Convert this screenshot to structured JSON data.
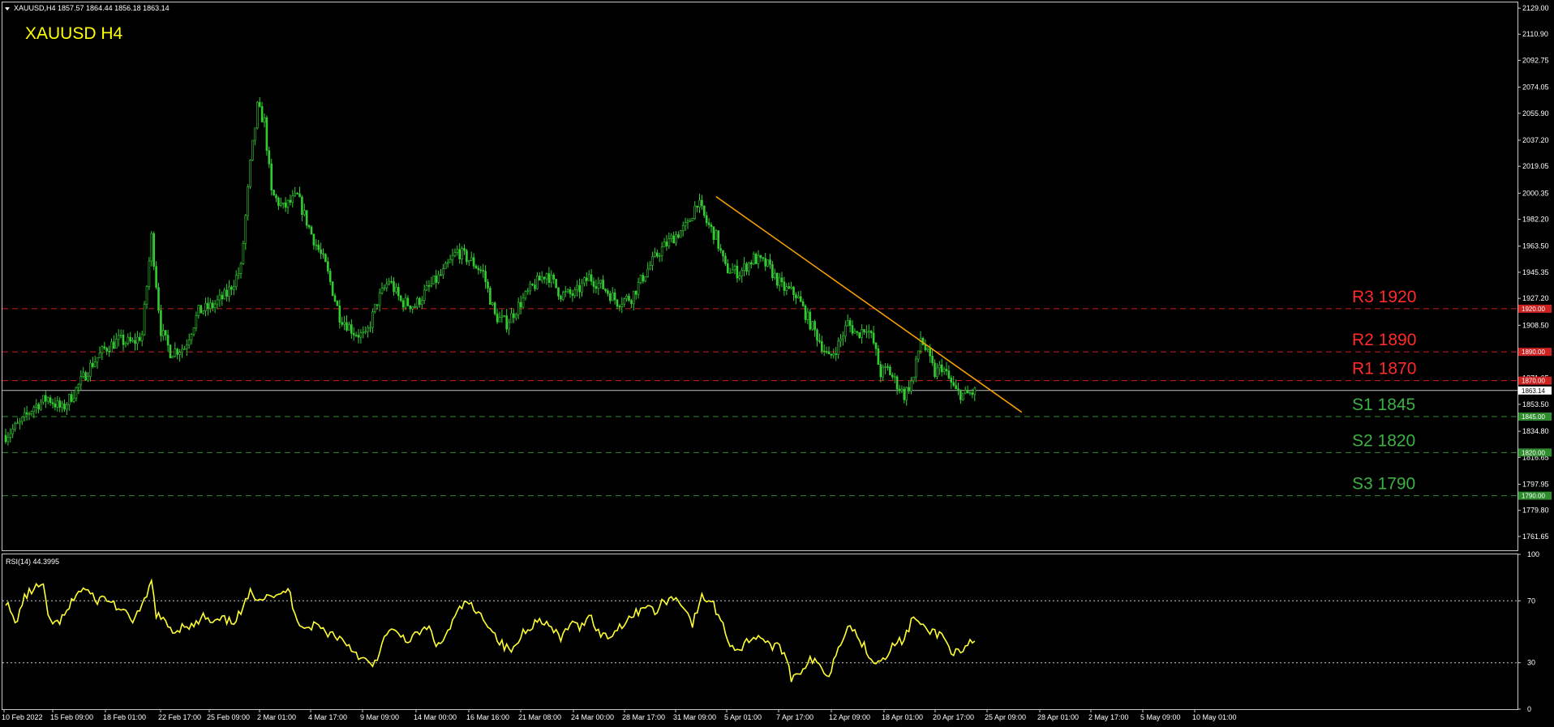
{
  "header": {
    "symbol_info": "XAUUSD,H4  1857.57 1864.44 1856.18 1863.14",
    "title": "XAUUSD H4"
  },
  "indicator": {
    "label": "RSI(14) 44.3995"
  },
  "colors": {
    "background": "#000000",
    "candle": "#33cc33",
    "rsi_line": "#ffff33",
    "trendline": "#ffa500",
    "resistance": "#cc2222",
    "support": "#2e8b2e",
    "current_price_line": "#c0c0c0",
    "title_text": "#ffff00",
    "resistance_text": "#ff2a2a",
    "support_text": "#3cb043"
  },
  "chart_data": [
    {
      "type": "candlestick",
      "title": "XAUUSD H4",
      "y_ticks": [
        "2129.00",
        "2110.90",
        "2092.75",
        "2074.05",
        "2055.90",
        "2037.20",
        "2019.05",
        "2000.35",
        "1982.20",
        "1963.50",
        "1945.35",
        "1927.20",
        "1908.50",
        "1871.65",
        "1853.50",
        "1834.80",
        "1816.65",
        "1797.95",
        "1779.80",
        "1761.65"
      ],
      "ylim": [
        1752,
        2133
      ],
      "x_ticks": [
        "10 Feb 2022",
        "15 Feb 09:00",
        "18 Feb 01:00",
        "22 Feb 17:00",
        "25 Feb 09:00",
        "2 Mar 01:00",
        "4 Mar 17:00",
        "9 Mar 09:00",
        "14 Mar 00:00",
        "16 Mar 16:00",
        "21 Mar 08:00",
        "24 Mar 00:00",
        "28 Mar 17:00",
        "31 Mar 09:00",
        "5 Apr 01:00",
        "7 Apr 17:00",
        "12 Apr 09:00",
        "18 Apr 01:00",
        "20 Apr 17:00",
        "25 Apr 09:00",
        "28 Apr 01:00",
        "2 May 17:00",
        "5 May 09:00",
        "10 May 01:00"
      ],
      "close_path": [
        [
          0,
          1832
        ],
        [
          6,
          1840
        ],
        [
          12,
          1852
        ],
        [
          18,
          1858
        ],
        [
          24,
          1850
        ],
        [
          30,
          1864
        ],
        [
          36,
          1880
        ],
        [
          42,
          1892
        ],
        [
          48,
          1898
        ],
        [
          54,
          1896
        ],
        [
          58,
          1902
        ],
        [
          62,
          1970
        ],
        [
          66,
          1905
        ],
        [
          70,
          1890
        ],
        [
          76,
          1893
        ],
        [
          82,
          1918
        ],
        [
          88,
          1922
        ],
        [
          94,
          1930
        ],
        [
          100,
          1948
        ],
        [
          104,
          2020
        ],
        [
          107,
          2060
        ],
        [
          110,
          2050
        ],
        [
          113,
          2000
        ],
        [
          118,
          1990
        ],
        [
          124,
          1998
        ],
        [
          130,
          1972
        ],
        [
          136,
          1950
        ],
        [
          142,
          1915
        ],
        [
          148,
          1904
        ],
        [
          153,
          1900
        ],
        [
          158,
          1925
        ],
        [
          163,
          1940
        ],
        [
          168,
          1925
        ],
        [
          174,
          1922
        ],
        [
          180,
          1935
        ],
        [
          186,
          1945
        ],
        [
          192,
          1960
        ],
        [
          198,
          1953
        ],
        [
          203,
          1945
        ],
        [
          208,
          1915
        ],
        [
          213,
          1910
        ],
        [
          218,
          1922
        ],
        [
          224,
          1935
        ],
        [
          230,
          1945
        ],
        [
          236,
          1930
        ],
        [
          242,
          1930
        ],
        [
          248,
          1942
        ],
        [
          254,
          1935
        ],
        [
          260,
          1925
        ],
        [
          266,
          1928
        ],
        [
          272,
          1945
        ],
        [
          278,
          1960
        ],
        [
          284,
          1970
        ],
        [
          290,
          1978
        ],
        [
          294,
          1995
        ],
        [
          298,
          1980
        ],
        [
          302,
          1970
        ],
        [
          306,
          1948
        ],
        [
          312,
          1945
        ],
        [
          318,
          1955
        ],
        [
          324,
          1950
        ],
        [
          330,
          1935
        ],
        [
          336,
          1930
        ],
        [
          342,
          1910
        ],
        [
          346,
          1898
        ],
        [
          350,
          1885
        ],
        [
          354,
          1895
        ],
        [
          358,
          1910
        ],
        [
          362,
          1902
        ],
        [
          366,
          1908
        ],
        [
          369,
          1896
        ],
        [
          372,
          1875
        ],
        [
          375,
          1878
        ],
        [
          378,
          1870
        ],
        [
          382,
          1860
        ],
        [
          386,
          1872
        ],
        [
          389,
          1900
        ],
        [
          392,
          1888
        ],
        [
          395,
          1875
        ],
        [
          398,
          1880
        ],
        [
          402,
          1868
        ],
        [
          404,
          1862
        ],
        [
          408,
          1860
        ],
        [
          412,
          1862
        ]
      ],
      "last_bar_index": 412,
      "current_price": 1863.14,
      "current_price_label": "1863.14",
      "levels": [
        {
          "name": "R3",
          "price": 1920,
          "text": "R3 1920",
          "axis_label": "1920.00",
          "kind": "resistance"
        },
        {
          "name": "R2",
          "price": 1890,
          "text": "R2 1890",
          "axis_label": "1890.00",
          "kind": "resistance"
        },
        {
          "name": "R1",
          "price": 1870,
          "text": "R1 1870",
          "axis_label": "1870.00",
          "kind": "resistance"
        },
        {
          "name": "S1",
          "price": 1845,
          "text": "S1 1845",
          "axis_label": "1845.00",
          "kind": "support"
        },
        {
          "name": "S2",
          "price": 1820,
          "text": "S2 1820",
          "axis_label": "1820.00",
          "kind": "support"
        },
        {
          "name": "S3",
          "price": 1790,
          "text": "S3 1790",
          "axis_label": "1790.00",
          "kind": "support"
        }
      ],
      "trendline": {
        "start": [
          302,
          1998
        ],
        "end": [
          432,
          1848
        ]
      }
    },
    {
      "type": "line",
      "title": "RSI(14) 44.3995",
      "ylim": [
        0,
        100
      ],
      "y_ticks": [
        "100",
        "70",
        "30",
        "0"
      ],
      "levels": [
        70,
        30
      ],
      "series": [
        {
          "name": "RSI(14)",
          "points": [
            [
              0,
              70
            ],
            [
              4,
              55
            ],
            [
              8,
              72
            ],
            [
              12,
              78
            ],
            [
              16,
              80
            ],
            [
              18,
              58
            ],
            [
              22,
              55
            ],
            [
              26,
              62
            ],
            [
              30,
              75
            ],
            [
              34,
              78
            ],
            [
              38,
              70
            ],
            [
              42,
              72
            ],
            [
              46,
              68
            ],
            [
              50,
              62
            ],
            [
              54,
              58
            ],
            [
              58,
              65
            ],
            [
              62,
              82
            ],
            [
              64,
              62
            ],
            [
              68,
              55
            ],
            [
              72,
              50
            ],
            [
              76,
              55
            ],
            [
              80,
              53
            ],
            [
              84,
              60
            ],
            [
              88,
              55
            ],
            [
              92,
              58
            ],
            [
              96,
              56
            ],
            [
              100,
              62
            ],
            [
              104,
              75
            ],
            [
              108,
              72
            ],
            [
              112,
              75
            ],
            [
              116,
              72
            ],
            [
              120,
              78
            ],
            [
              124,
              58
            ],
            [
              128,
              52
            ],
            [
              132,
              55
            ],
            [
              136,
              50
            ],
            [
              140,
              48
            ],
            [
              144,
              44
            ],
            [
              148,
              38
            ],
            [
              152,
              32
            ],
            [
              156,
              28
            ],
            [
              158,
              30
            ],
            [
              160,
              45
            ],
            [
              164,
              50
            ],
            [
              168,
              48
            ],
            [
              172,
              44
            ],
            [
              176,
              50
            ],
            [
              180,
              52
            ],
            [
              184,
              40
            ],
            [
              188,
              50
            ],
            [
              192,
              62
            ],
            [
              196,
              70
            ],
            [
              200,
              62
            ],
            [
              204,
              58
            ],
            [
              208,
              48
            ],
            [
              212,
              40
            ],
            [
              216,
              38
            ],
            [
              220,
              50
            ],
            [
              224,
              55
            ],
            [
              228,
              58
            ],
            [
              232,
              52
            ],
            [
              236,
              45
            ],
            [
              240,
              56
            ],
            [
              244,
              52
            ],
            [
              248,
              62
            ],
            [
              252,
              50
            ],
            [
              256,
              46
            ],
            [
              260,
              52
            ],
            [
              264,
              58
            ],
            [
              268,
              62
            ],
            [
              272,
              68
            ],
            [
              276,
              62
            ],
            [
              280,
              70
            ],
            [
              284,
              72
            ],
            [
              288,
              68
            ],
            [
              292,
              55
            ],
            [
              296,
              72
            ],
            [
              300,
              70
            ],
            [
              304,
              58
            ],
            [
              308,
              42
            ],
            [
              312,
              38
            ],
            [
              316,
              45
            ],
            [
              320,
              48
            ],
            [
              324,
              42
            ],
            [
              328,
              40
            ],
            [
              332,
              35
            ],
            [
              334,
              20
            ],
            [
              338,
              25
            ],
            [
              342,
              32
            ],
            [
              346,
              28
            ],
            [
              350,
              22
            ],
            [
              354,
              40
            ],
            [
              358,
              55
            ],
            [
              362,
              48
            ],
            [
              366,
              38
            ],
            [
              370,
              30
            ],
            [
              374,
              35
            ],
            [
              378,
              42
            ],
            [
              382,
              45
            ],
            [
              386,
              60
            ],
            [
              390,
              52
            ],
            [
              394,
              50
            ],
            [
              398,
              48
            ],
            [
              402,
              38
            ],
            [
              406,
              35
            ],
            [
              410,
              42
            ],
            [
              412,
              44
            ]
          ]
        }
      ]
    }
  ]
}
